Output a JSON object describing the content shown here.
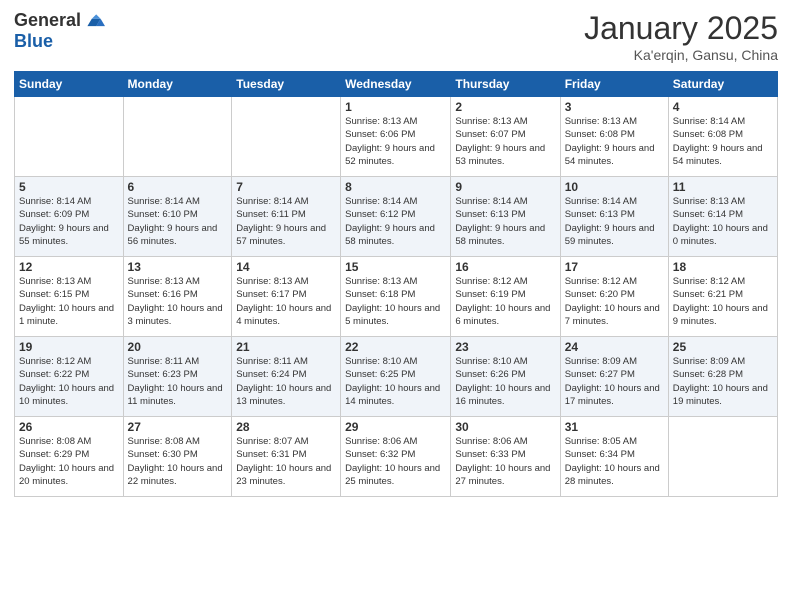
{
  "header": {
    "logo_general": "General",
    "logo_blue": "Blue",
    "month_title": "January 2025",
    "location": "Ka'erqin, Gansu, China"
  },
  "weekdays": [
    "Sunday",
    "Monday",
    "Tuesday",
    "Wednesday",
    "Thursday",
    "Friday",
    "Saturday"
  ],
  "weeks": [
    [
      {
        "day": "",
        "info": ""
      },
      {
        "day": "",
        "info": ""
      },
      {
        "day": "",
        "info": ""
      },
      {
        "day": "1",
        "info": "Sunrise: 8:13 AM\nSunset: 6:06 PM\nDaylight: 9 hours and 52 minutes."
      },
      {
        "day": "2",
        "info": "Sunrise: 8:13 AM\nSunset: 6:07 PM\nDaylight: 9 hours and 53 minutes."
      },
      {
        "day": "3",
        "info": "Sunrise: 8:13 AM\nSunset: 6:08 PM\nDaylight: 9 hours and 54 minutes."
      },
      {
        "day": "4",
        "info": "Sunrise: 8:14 AM\nSunset: 6:08 PM\nDaylight: 9 hours and 54 minutes."
      }
    ],
    [
      {
        "day": "5",
        "info": "Sunrise: 8:14 AM\nSunset: 6:09 PM\nDaylight: 9 hours and 55 minutes."
      },
      {
        "day": "6",
        "info": "Sunrise: 8:14 AM\nSunset: 6:10 PM\nDaylight: 9 hours and 56 minutes."
      },
      {
        "day": "7",
        "info": "Sunrise: 8:14 AM\nSunset: 6:11 PM\nDaylight: 9 hours and 57 minutes."
      },
      {
        "day": "8",
        "info": "Sunrise: 8:14 AM\nSunset: 6:12 PM\nDaylight: 9 hours and 58 minutes."
      },
      {
        "day": "9",
        "info": "Sunrise: 8:14 AM\nSunset: 6:13 PM\nDaylight: 9 hours and 58 minutes."
      },
      {
        "day": "10",
        "info": "Sunrise: 8:14 AM\nSunset: 6:13 PM\nDaylight: 9 hours and 59 minutes."
      },
      {
        "day": "11",
        "info": "Sunrise: 8:13 AM\nSunset: 6:14 PM\nDaylight: 10 hours and 0 minutes."
      }
    ],
    [
      {
        "day": "12",
        "info": "Sunrise: 8:13 AM\nSunset: 6:15 PM\nDaylight: 10 hours and 1 minute."
      },
      {
        "day": "13",
        "info": "Sunrise: 8:13 AM\nSunset: 6:16 PM\nDaylight: 10 hours and 3 minutes."
      },
      {
        "day": "14",
        "info": "Sunrise: 8:13 AM\nSunset: 6:17 PM\nDaylight: 10 hours and 4 minutes."
      },
      {
        "day": "15",
        "info": "Sunrise: 8:13 AM\nSunset: 6:18 PM\nDaylight: 10 hours and 5 minutes."
      },
      {
        "day": "16",
        "info": "Sunrise: 8:12 AM\nSunset: 6:19 PM\nDaylight: 10 hours and 6 minutes."
      },
      {
        "day": "17",
        "info": "Sunrise: 8:12 AM\nSunset: 6:20 PM\nDaylight: 10 hours and 7 minutes."
      },
      {
        "day": "18",
        "info": "Sunrise: 8:12 AM\nSunset: 6:21 PM\nDaylight: 10 hours and 9 minutes."
      }
    ],
    [
      {
        "day": "19",
        "info": "Sunrise: 8:12 AM\nSunset: 6:22 PM\nDaylight: 10 hours and 10 minutes."
      },
      {
        "day": "20",
        "info": "Sunrise: 8:11 AM\nSunset: 6:23 PM\nDaylight: 10 hours and 11 minutes."
      },
      {
        "day": "21",
        "info": "Sunrise: 8:11 AM\nSunset: 6:24 PM\nDaylight: 10 hours and 13 minutes."
      },
      {
        "day": "22",
        "info": "Sunrise: 8:10 AM\nSunset: 6:25 PM\nDaylight: 10 hours and 14 minutes."
      },
      {
        "day": "23",
        "info": "Sunrise: 8:10 AM\nSunset: 6:26 PM\nDaylight: 10 hours and 16 minutes."
      },
      {
        "day": "24",
        "info": "Sunrise: 8:09 AM\nSunset: 6:27 PM\nDaylight: 10 hours and 17 minutes."
      },
      {
        "day": "25",
        "info": "Sunrise: 8:09 AM\nSunset: 6:28 PM\nDaylight: 10 hours and 19 minutes."
      }
    ],
    [
      {
        "day": "26",
        "info": "Sunrise: 8:08 AM\nSunset: 6:29 PM\nDaylight: 10 hours and 20 minutes."
      },
      {
        "day": "27",
        "info": "Sunrise: 8:08 AM\nSunset: 6:30 PM\nDaylight: 10 hours and 22 minutes."
      },
      {
        "day": "28",
        "info": "Sunrise: 8:07 AM\nSunset: 6:31 PM\nDaylight: 10 hours and 23 minutes."
      },
      {
        "day": "29",
        "info": "Sunrise: 8:06 AM\nSunset: 6:32 PM\nDaylight: 10 hours and 25 minutes."
      },
      {
        "day": "30",
        "info": "Sunrise: 8:06 AM\nSunset: 6:33 PM\nDaylight: 10 hours and 27 minutes."
      },
      {
        "day": "31",
        "info": "Sunrise: 8:05 AM\nSunset: 6:34 PM\nDaylight: 10 hours and 28 minutes."
      },
      {
        "day": "",
        "info": ""
      }
    ]
  ]
}
